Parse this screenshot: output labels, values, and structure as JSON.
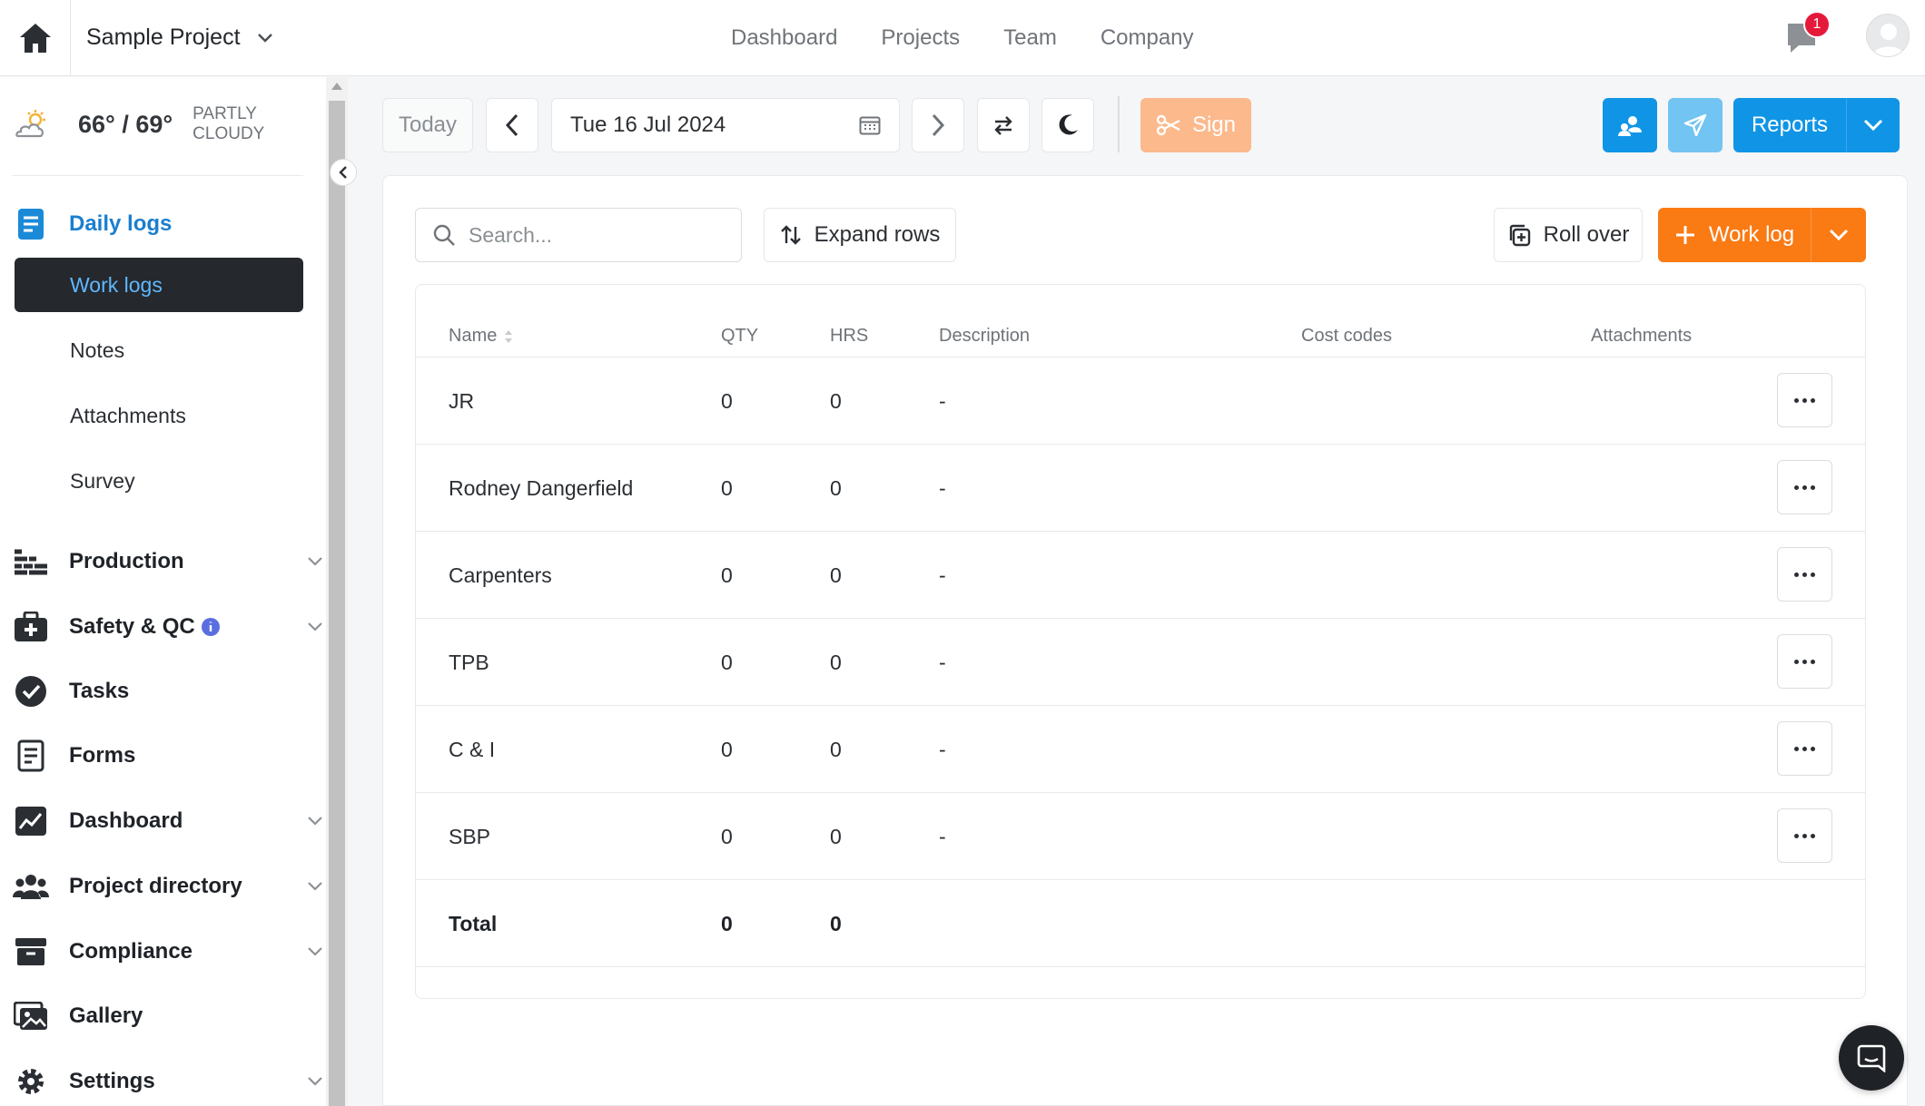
{
  "header": {
    "project_name": "Sample Project",
    "nav": [
      "Dashboard",
      "Projects",
      "Team",
      "Company"
    ],
    "notifications_count": "1"
  },
  "weather": {
    "temp": "66° / 69°",
    "condition_line1": "PARTLY",
    "condition_line2": "CLOUDY"
  },
  "sidebar": {
    "daily_logs": "Daily logs",
    "sub_items": [
      "Work logs",
      "Notes",
      "Attachments",
      "Survey"
    ],
    "items": [
      "Production",
      "Safety & QC",
      "Tasks",
      "Forms",
      "Dashboard",
      "Project directory",
      "Compliance",
      "Gallery",
      "Settings"
    ]
  },
  "toolbar": {
    "today": "Today",
    "date": "Tue 16 Jul 2024",
    "sign": "Sign",
    "reports": "Reports"
  },
  "actions": {
    "search_placeholder": "Search...",
    "expand_rows": "Expand rows",
    "roll_over": "Roll over",
    "work_log": "Work log"
  },
  "table": {
    "columns": [
      "Name",
      "QTY",
      "HRS",
      "Description",
      "Cost codes",
      "Attachments"
    ],
    "rows": [
      {
        "name": "JR",
        "qty": "0",
        "hrs": "0",
        "description": "-"
      },
      {
        "name": "Rodney Dangerfield",
        "qty": "0",
        "hrs": "0",
        "description": "-"
      },
      {
        "name": "Carpenters",
        "qty": "0",
        "hrs": "0",
        "description": "-"
      },
      {
        "name": "TPB",
        "qty": "0",
        "hrs": "0",
        "description": "-"
      },
      {
        "name": "C & I",
        "qty": "0",
        "hrs": "0",
        "description": "-"
      },
      {
        "name": "SBP",
        "qty": "0",
        "hrs": "0",
        "description": "-"
      }
    ],
    "total": {
      "label": "Total",
      "qty": "0",
      "hrs": "0"
    }
  },
  "colors": {
    "accent_blue": "#1095e6",
    "accent_orange": "#fa7a14",
    "sign_orange": "#fbb98c",
    "active_nav_bg": "#25282c",
    "active_nav_text": "#5fb8ff",
    "badge_red": "#e5193a"
  }
}
